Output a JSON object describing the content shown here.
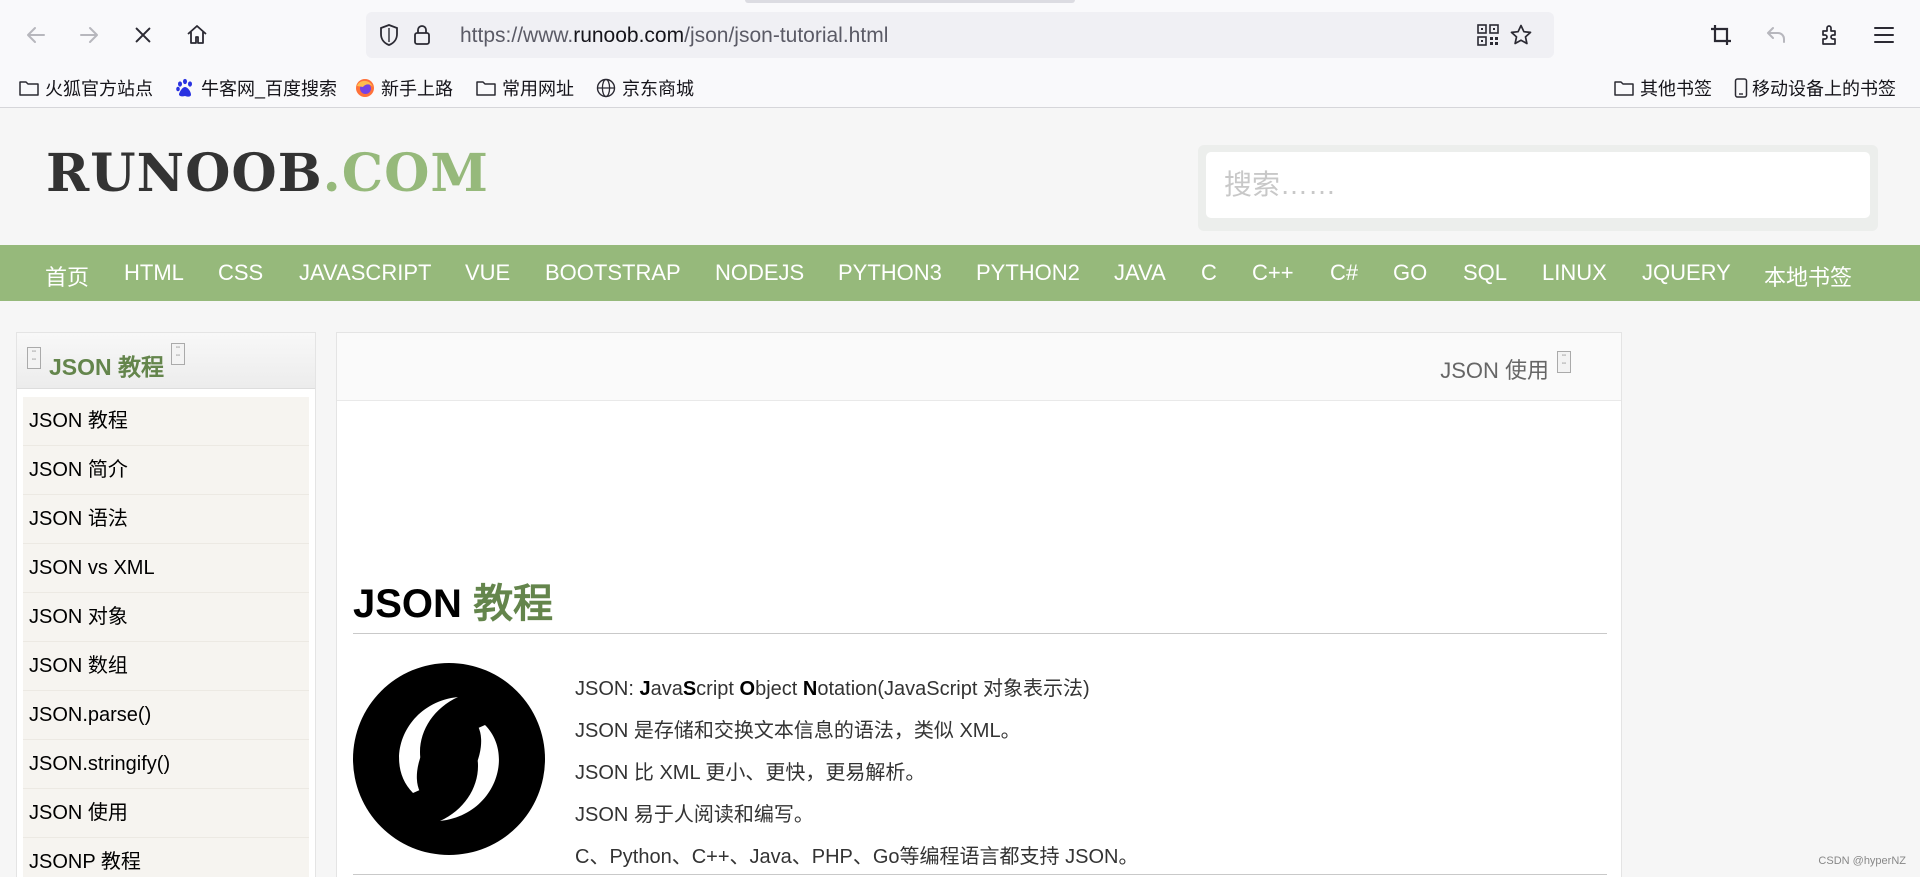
{
  "browser": {
    "url_prefix": "https://www.",
    "url_domain": "runoob.com",
    "url_path": "/json/json-tutorial.html",
    "icons": [
      "back-arrow-icon",
      "forward-arrow-icon",
      "stop-loading-icon",
      "home-icon",
      "shield-icon",
      "lock-icon",
      "qr-code-icon",
      "star-icon",
      "crop-icon",
      "undo-icon",
      "extensions-icon",
      "menu-icon"
    ]
  },
  "bookmarks": {
    "left": [
      {
        "label": "火狐官方站点",
        "icon": "folder-icon"
      },
      {
        "label": "牛客网_百度搜索",
        "icon": "baidu-paw-icon"
      },
      {
        "label": "新手上路",
        "icon": "firefox-icon"
      },
      {
        "label": "常用网址",
        "icon": "folder-icon"
      },
      {
        "label": "京东商城",
        "icon": "globe-icon"
      }
    ],
    "right": [
      {
        "label": "其他书签",
        "icon": "folder-icon"
      },
      {
        "label": "移动设备上的书签",
        "icon": "mobile-icon"
      }
    ]
  },
  "site": {
    "logo_dark": "RUNOOB",
    "logo_green": ".COM",
    "search_placeholder": "搜索……",
    "nav": [
      "首页",
      "HTML",
      "CSS",
      "JAVASCRIPT",
      "VUE",
      "BOOTSTRAP",
      "NODEJS",
      "PYTHON3",
      "PYTHON2",
      "JAVA",
      "C",
      "C++",
      "C#",
      "GO",
      "SQL",
      "LINUX",
      "JQUERY",
      "本地书签"
    ]
  },
  "sidebar": {
    "title": "JSON 教程",
    "items": [
      "JSON 教程",
      "JSON 简介",
      "JSON 语法",
      "JSON vs XML",
      "JSON 对象",
      "JSON 数组",
      "JSON.parse()",
      "JSON.stringify()",
      "JSON 使用",
      "JSONP 教程"
    ]
  },
  "content": {
    "next_link": "JSON 使用",
    "heading_black": "JSON",
    "heading_green": "教程",
    "p1_prefix": "JSON: ",
    "p1_J": "J",
    "p1_ava": "ava",
    "p1_S": "S",
    "p1_cript": "cript ",
    "p1_O": "O",
    "p1_bject": "bject ",
    "p1_N": "N",
    "p1_rest": "otation(JavaScript 对象表示法)",
    "p2": "JSON 是存储和交换文本信息的语法，类似 XML。",
    "p3": "JSON 比 XML 更小、更快，更易解析。",
    "p4": "JSON 易于人阅读和编写。",
    "p5": "C、Python、C++、Java、PHP、Go等编程语言都支持 JSON。"
  },
  "watermark": "CSDN @hyperNZ",
  "colors": {
    "brand_green": "#96b97b",
    "heading_green": "#64854c"
  }
}
